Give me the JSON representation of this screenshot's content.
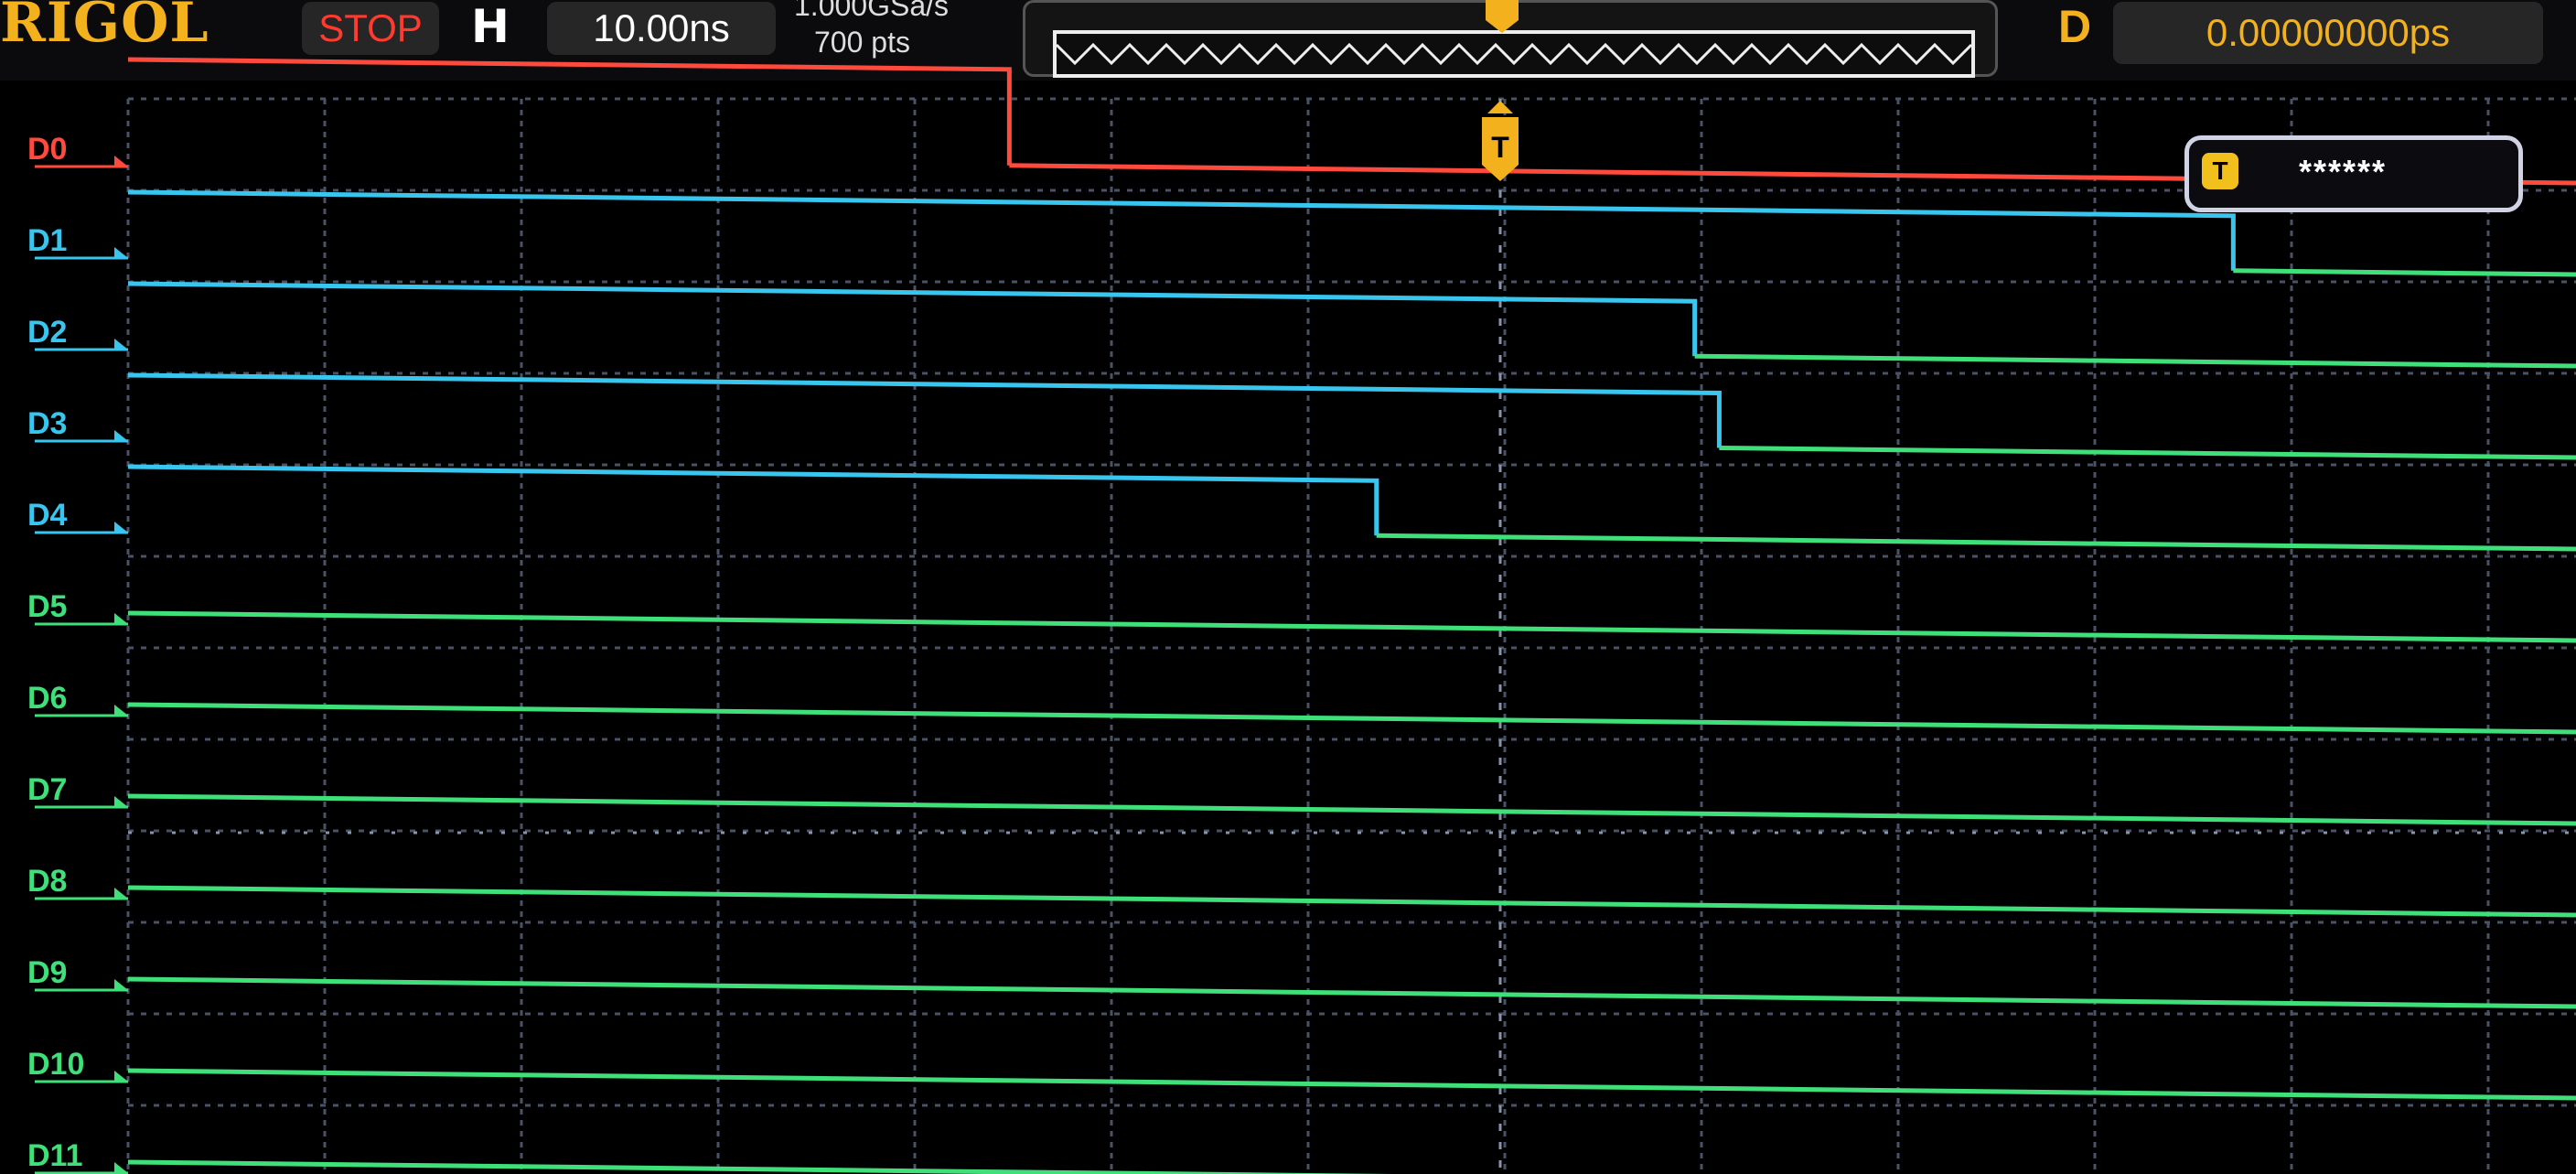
{
  "header": {
    "brand": "RIGOL",
    "run_status": "STOP",
    "horizontal_key": "H",
    "timebase": "10.00ns",
    "sample_rate": "1.000GSa/s",
    "memory_depth": "700 pts",
    "delay_key": "D",
    "delay_value": "0.00000000ps"
  },
  "trigger": {
    "marker": "T",
    "level": "******"
  },
  "colors": {
    "d0": "#ff4a3d",
    "high": "#38c6ee",
    "low": "#3fe07a",
    "grid": "#4a5266",
    "accent": "#f2b11d"
  },
  "channels": [
    {
      "name": "D0",
      "color": "#ff4a3d",
      "initial": "high",
      "transition": 0.36
    },
    {
      "name": "D1",
      "color": "#38c6ee",
      "initial": "high",
      "transition": 0.86
    },
    {
      "name": "D2",
      "color": "#38c6ee",
      "initial": "high",
      "transition": 0.64
    },
    {
      "name": "D3",
      "color": "#38c6ee",
      "initial": "high",
      "transition": 0.65
    },
    {
      "name": "D4",
      "color": "#38c6ee",
      "initial": "high",
      "transition": 0.51
    },
    {
      "name": "D5",
      "color": "#3fe07a",
      "initial": "low"
    },
    {
      "name": "D6",
      "color": "#3fe07a",
      "initial": "low"
    },
    {
      "name": "D7",
      "color": "#3fe07a",
      "initial": "low"
    },
    {
      "name": "D8",
      "color": "#3fe07a",
      "initial": "low"
    },
    {
      "name": "D9",
      "color": "#3fe07a",
      "initial": "low"
    },
    {
      "name": "D10",
      "color": "#3fe07a",
      "initial": "low"
    },
    {
      "name": "D11",
      "color": "#3fe07a",
      "initial": "low"
    }
  ]
}
